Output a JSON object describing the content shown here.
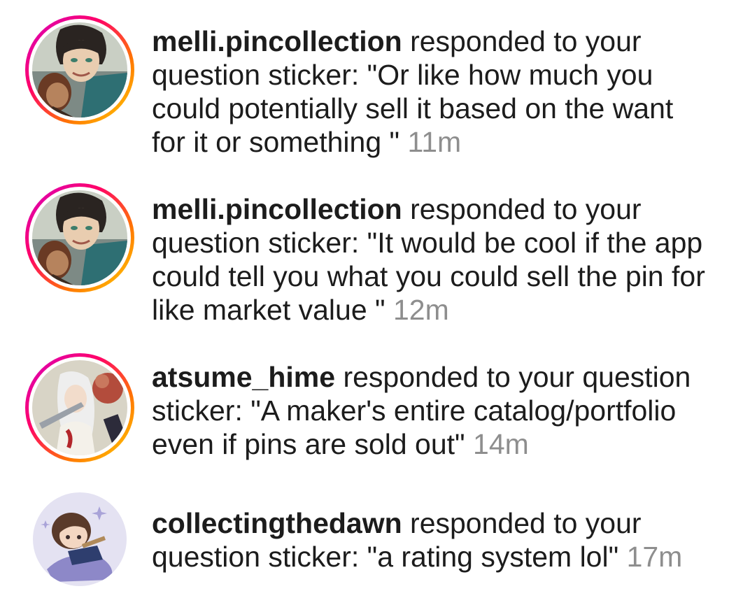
{
  "activity": {
    "items": [
      {
        "username": "melli.pincollection",
        "action": " responded to your\nquestion sticker: ",
        "response": "\"Or like how much you\ncould potentially sell it based on the want\nfor it or something \"",
        "time": "11m",
        "avatar_icon": "anime-character-avatar",
        "has_story_ring": true
      },
      {
        "username": "melli.pincollection",
        "action": " responded to your\nquestion sticker: ",
        "response": "\"It would be cool if the app\ncould tell you what you could sell the pin for\nlike market value \"",
        "time": "12m",
        "avatar_icon": "anime-character-avatar",
        "has_story_ring": true
      },
      {
        "username": "atsume_hime",
        "action": " responded to your question\nsticker: ",
        "response": "\"A maker's entire catalog/portfolio\neven if pins are sold out\"",
        "time": "14m",
        "avatar_icon": "anime-pin-art-avatar",
        "has_story_ring": true
      },
      {
        "username": "collectingthedawn",
        "action": " responded to your\nquestion sticker: ",
        "response": "\"a rating system lol\"",
        "time": "17m",
        "avatar_icon": "chibi-character-avatar",
        "has_story_ring": false
      }
    ]
  }
}
